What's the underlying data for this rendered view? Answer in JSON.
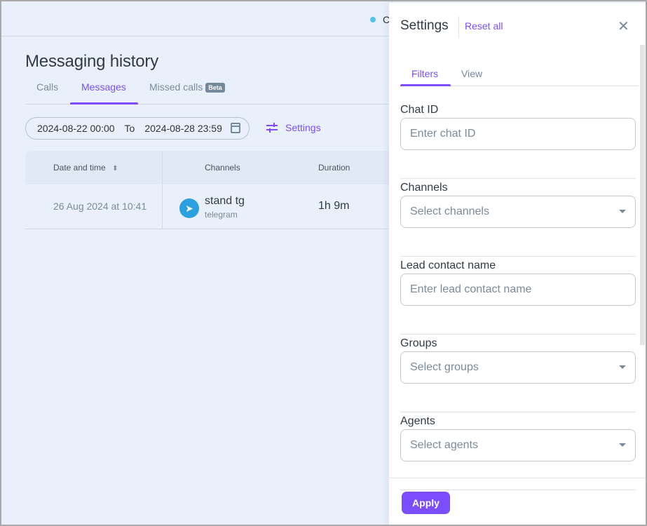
{
  "header": {
    "status_text": "C",
    "status_color": "#4fc3ea"
  },
  "page": {
    "title": "Messaging history"
  },
  "tabs": [
    {
      "label": "Calls"
    },
    {
      "label": "Messages",
      "active": true
    },
    {
      "label": "Missed calls",
      "badge": "Beta"
    }
  ],
  "filters": {
    "date_from": "2024-08-22 00:00",
    "to_label": "To",
    "date_to": "2024-08-28 23:59",
    "settings_label": "Settings"
  },
  "table": {
    "columns": [
      "Date and time",
      "Channels",
      "Duration"
    ],
    "rows": [
      {
        "date": "26 Aug 2024 at 10:41",
        "channel_name": "stand tg",
        "channel_type": "telegram",
        "duration": "1h 9m"
      }
    ]
  },
  "settings_panel": {
    "title": "Settings",
    "reset_label": "Reset all",
    "tabs": [
      {
        "label": "Filters",
        "active": true
      },
      {
        "label": "View"
      }
    ],
    "fields": [
      {
        "label": "Chat ID",
        "placeholder": "Enter chat ID",
        "type": "input"
      },
      {
        "label": "Channels",
        "placeholder": "Select channels",
        "type": "select"
      },
      {
        "label": "Lead contact name",
        "placeholder": "Enter lead contact name",
        "type": "input"
      },
      {
        "label": "Groups",
        "placeholder": "Select groups",
        "type": "select"
      },
      {
        "label": "Agents",
        "placeholder": "Select agents",
        "type": "select"
      }
    ],
    "apply_label": "Apply"
  },
  "colors": {
    "accent": "#7b4dff",
    "background": "#e9f0fc",
    "telegram": "#2aa0e0"
  }
}
